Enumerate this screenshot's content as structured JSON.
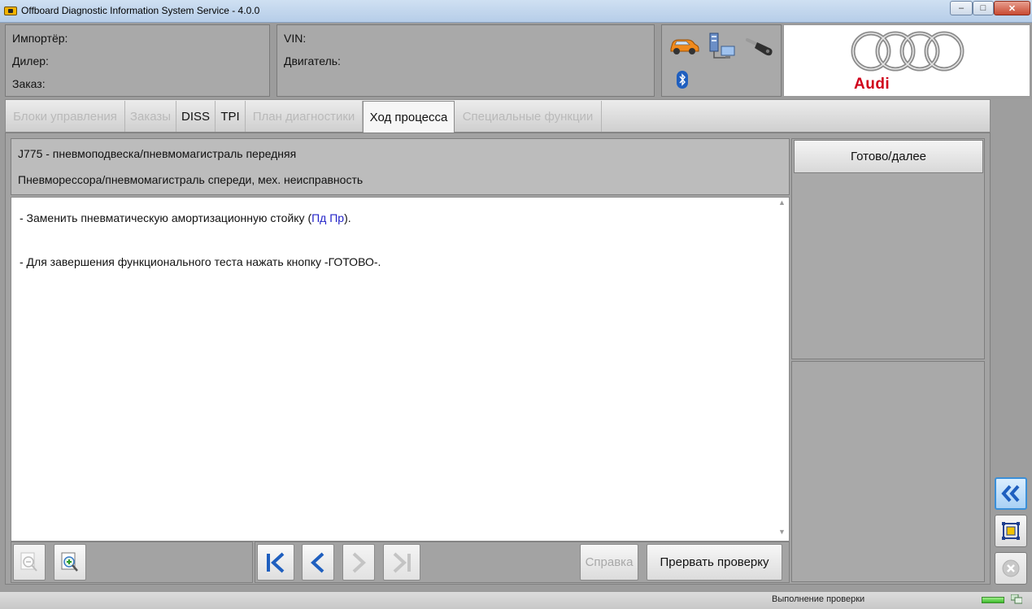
{
  "window": {
    "title": "Offboard Diagnostic Information System Service - 4.0.0",
    "minimize": "–",
    "maximize": "□",
    "close": "✕"
  },
  "header": {
    "importer_label": "Импортёр:",
    "dealer_label": "Дилер:",
    "order_label": "Заказ:",
    "vin_label": "VIN:",
    "engine_label": "Двигатель:",
    "icons": [
      "car-icon",
      "network-icon",
      "key-icon",
      "bluetooth-icon"
    ],
    "logo_text": "Audi",
    "logo_color": "#d0021b"
  },
  "tabs": [
    {
      "label": "Блоки управления",
      "state": "disabled"
    },
    {
      "label": "Заказы",
      "state": "disabled"
    },
    {
      "label": "DISS",
      "state": "enabled"
    },
    {
      "label": "TPI",
      "state": "enabled"
    },
    {
      "label": "План диагностики",
      "state": "disabled"
    },
    {
      "label": "Ход процесса",
      "state": "active"
    },
    {
      "label": "Специальные функции",
      "state": "disabled"
    }
  ],
  "procedure": {
    "heading_component": "J775 - пневмоподвеска/пневмомагистраль передняя",
    "heading_fault": "Пневморессора/пневмомагистраль спереди, мех. неисправность",
    "line1_prefix": "- Заменить пневматическую амортизационную стойку (",
    "line1_link": "Пд Пр",
    "line1_suffix": ").",
    "line2": "- Для завершения функционального теста нажать кнопку -ГОТОВО-."
  },
  "actions": {
    "done_next": "Готово/далее",
    "help": "Справка",
    "abort": "Прервать проверку"
  },
  "status": {
    "text": "Выполнение проверки"
  }
}
